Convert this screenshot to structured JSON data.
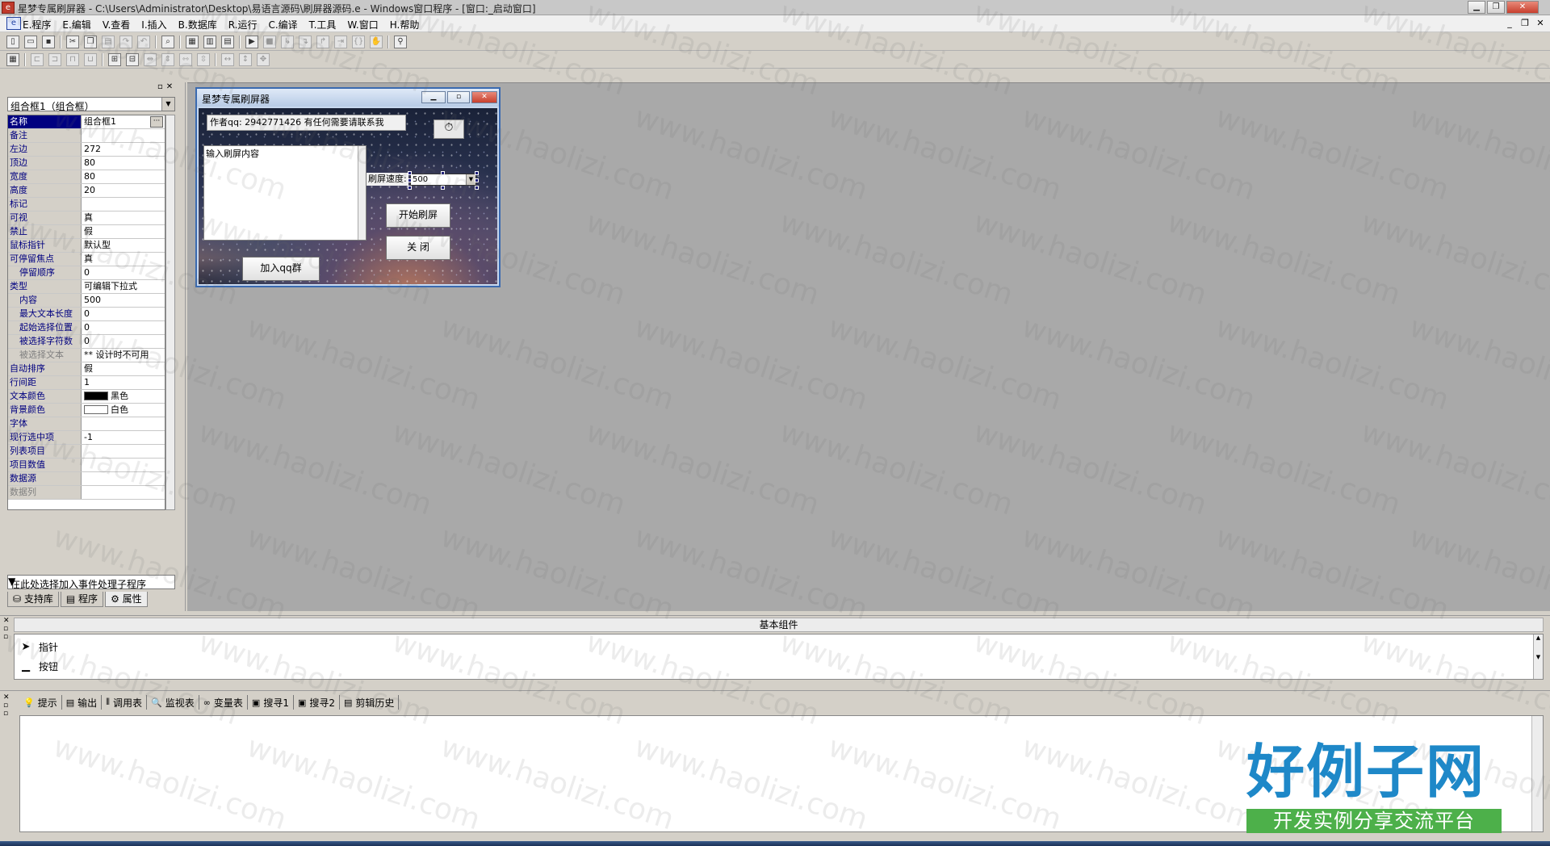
{
  "window": {
    "title": "星梦专属刷屏器 - C:\\Users\\Administrator\\Desktop\\易语言源码\\刷屏器源码.e - Windows窗口程序 - [窗口:_启动窗口]",
    "icon": "e-app-icon",
    "minimize_glyph": "▁",
    "restore_glyph": "❐",
    "close_glyph": "✕"
  },
  "menubar": {
    "items": [
      "E.程序",
      "E.编辑",
      "V.查看",
      "I.插入",
      "B.数据库",
      "R.运行",
      "C.编译",
      "T.工具",
      "W.窗口",
      "H.帮助"
    ],
    "mdi_buttons": [
      "_",
      "❐",
      "✕"
    ]
  },
  "property_panel": {
    "object_selector": "组合框1（组合框）",
    "properties": [
      {
        "name": "名称",
        "value": "组合框1",
        "selected": true
      },
      {
        "name": "备注",
        "value": ""
      },
      {
        "name": "左边",
        "value": "272"
      },
      {
        "name": "顶边",
        "value": "80"
      },
      {
        "name": "宽度",
        "value": "80"
      },
      {
        "name": "高度",
        "value": "20"
      },
      {
        "name": "标记",
        "value": ""
      },
      {
        "name": "可视",
        "value": "真"
      },
      {
        "name": "禁止",
        "value": "假"
      },
      {
        "name": "鼠标指针",
        "value": "默认型"
      },
      {
        "name": "可停留焦点",
        "value": "真"
      },
      {
        "name": "停留顺序",
        "value": "0",
        "indent": true
      },
      {
        "name": "类型",
        "value": "可编辑下拉式"
      },
      {
        "name": "内容",
        "value": "500",
        "indent": true
      },
      {
        "name": "最大文本长度",
        "value": "0",
        "indent": true
      },
      {
        "name": "起始选择位置",
        "value": "0",
        "indent": true
      },
      {
        "name": "被选择字符数",
        "value": "0",
        "indent": true
      },
      {
        "name": "被选择文本",
        "value": "** 设计时不可用",
        "indent": true,
        "disabled": true
      },
      {
        "name": "自动排序",
        "value": "假"
      },
      {
        "name": "行间距",
        "value": "1"
      },
      {
        "name": "文本颜色",
        "value": "黑色",
        "swatch": "#000000"
      },
      {
        "name": "背景颜色",
        "value": "白色",
        "swatch": "#ffffff"
      },
      {
        "name": "字体",
        "value": ""
      },
      {
        "name": "现行选中项",
        "value": "-1"
      },
      {
        "name": "列表项目",
        "value": ""
      },
      {
        "name": "项目数值",
        "value": ""
      },
      {
        "name": "数据源",
        "value": ""
      },
      {
        "name": "数据列",
        "value": "",
        "disabled": true
      }
    ],
    "event_selector": "在此处选择加入事件处理子程序",
    "tabs": [
      "支持库",
      "程序",
      "属性"
    ],
    "active_tab": "属性"
  },
  "form": {
    "title": "星梦专属刷屏器",
    "author_label": "作者qq: 2942771426    有任何需要请联系我",
    "memo_text": "输入刷屏内容",
    "speed_label": "刷屏速度:",
    "speed_value": "500",
    "start_button": "开始刷屏",
    "close_button": "关 闭",
    "join_button": "加入qq群",
    "timer_icon": "⏱"
  },
  "component_bar": {
    "title": "基本组件",
    "items": [
      {
        "label": "指针",
        "icon": "pointer-icon",
        "glyph": "➤"
      },
      {
        "label": "按钮",
        "icon": "button-icon",
        "glyph": "▁"
      }
    ]
  },
  "bottom_tabs": [
    {
      "label": "提示",
      "icon": "hint-icon",
      "glyph": "💡"
    },
    {
      "label": "输出",
      "icon": "output-icon",
      "glyph": "▤"
    },
    {
      "label": "调用表",
      "icon": "callstack-icon",
      "glyph": "⦀"
    },
    {
      "label": "监视表",
      "icon": "watch-icon",
      "glyph": "🔍"
    },
    {
      "label": "变量表",
      "icon": "variables-icon",
      "glyph": "∞"
    },
    {
      "label": "搜寻1",
      "icon": "search1-icon",
      "glyph": "▣"
    },
    {
      "label": "搜寻2",
      "icon": "search2-icon",
      "glyph": "▣"
    },
    {
      "label": "剪辑历史",
      "icon": "clipboard-icon",
      "glyph": "▤"
    }
  ],
  "watermark": "www.haolizi.com",
  "logo": {
    "main": "好例子网",
    "tagline": "开发实例分享交流平台",
    "main_color": "#1e88c8",
    "tagline_bg": "#4db04a"
  }
}
